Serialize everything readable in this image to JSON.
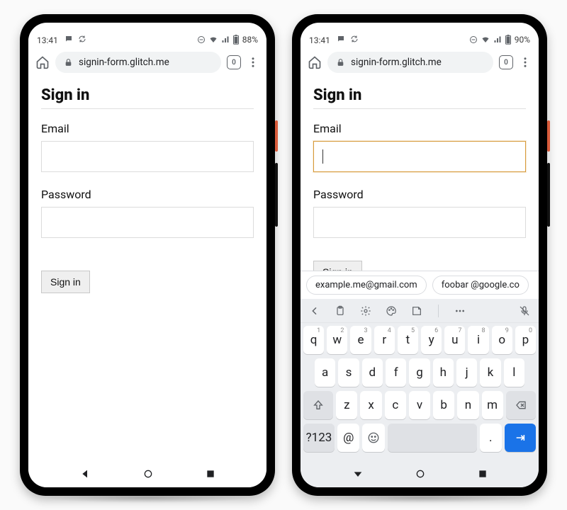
{
  "left": {
    "status": {
      "time": "13:41",
      "battery": "88%"
    },
    "address": {
      "url": "signin-form.glitch.me",
      "tab_count": "0"
    },
    "page": {
      "title": "Sign in",
      "email_label": "Email",
      "email_value": "",
      "password_label": "Password",
      "password_value": "",
      "submit_label": "Sign in"
    }
  },
  "right": {
    "status": {
      "time": "13:41",
      "battery": "90%"
    },
    "address": {
      "url": "signin-form.glitch.me",
      "tab_count": "0"
    },
    "page": {
      "title": "Sign in",
      "email_label": "Email",
      "email_value": "",
      "password_label": "Password",
      "password_value": "",
      "submit_label": "Sign in"
    },
    "suggestions": [
      "example.me@gmail.com",
      "foobar @google.co"
    ],
    "keyboard": {
      "row1": [
        "q",
        "w",
        "e",
        "r",
        "t",
        "y",
        "u",
        "i",
        "o",
        "p"
      ],
      "row1_nums": [
        "1",
        "2",
        "3",
        "4",
        "5",
        "6",
        "7",
        "8",
        "9",
        "0"
      ],
      "row2": [
        "a",
        "s",
        "d",
        "f",
        "g",
        "h",
        "j",
        "k",
        "l"
      ],
      "row3": [
        "z",
        "x",
        "c",
        "v",
        "b",
        "n",
        "m"
      ],
      "sym_key": "?123",
      "at_key": "@",
      "period_key": "."
    }
  }
}
